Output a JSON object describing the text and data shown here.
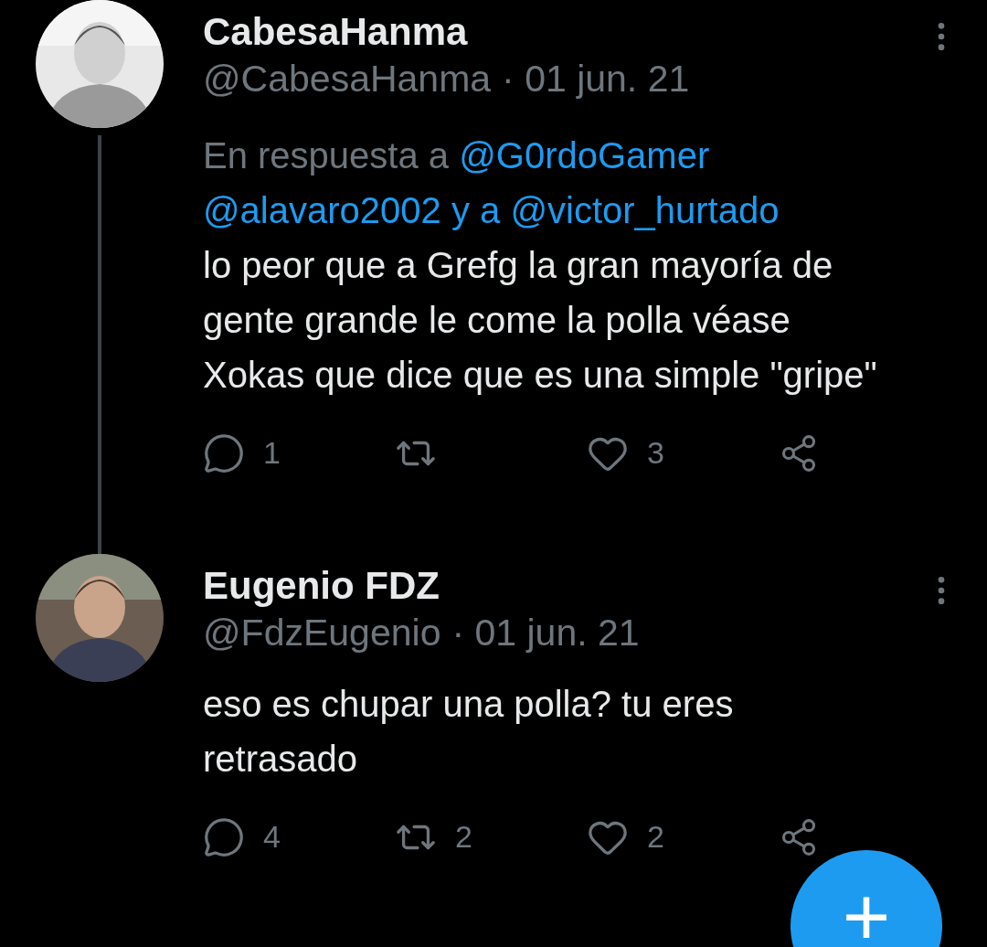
{
  "tweets": [
    {
      "name": "CabesaHanma",
      "handle": "@CabesaHanma",
      "date": "· 01 jun. 21",
      "thread_line": true,
      "reply_to": [
        {
          "kind": "plain",
          "text": "En respuesta a"
        },
        {
          "kind": "mention",
          "text": "@G0rdoGamer"
        },
        {
          "kind": "mention",
          "text": "@alavaro2002"
        },
        {
          "kind": "connector",
          "text": "y a"
        },
        {
          "kind": "mention",
          "text": "@victor_hurtado"
        }
      ],
      "text": "lo peor que a Grefg la gran mayoría de gente grande le come la polla véase Xokas que dice que es una simple \"gripe\"",
      "replies": "1",
      "likes": "3"
    },
    {
      "name": "Eugenio FDZ",
      "handle": "@FdzEugenio",
      "date": "· 01 jun. 21",
      "thread_line": false,
      "text": "eso es chupar una polla? tu eres retrasado",
      "replies": "4",
      "retweets": "2",
      "likes": "2"
    }
  ],
  "compose_button": {
    "label": "+"
  }
}
